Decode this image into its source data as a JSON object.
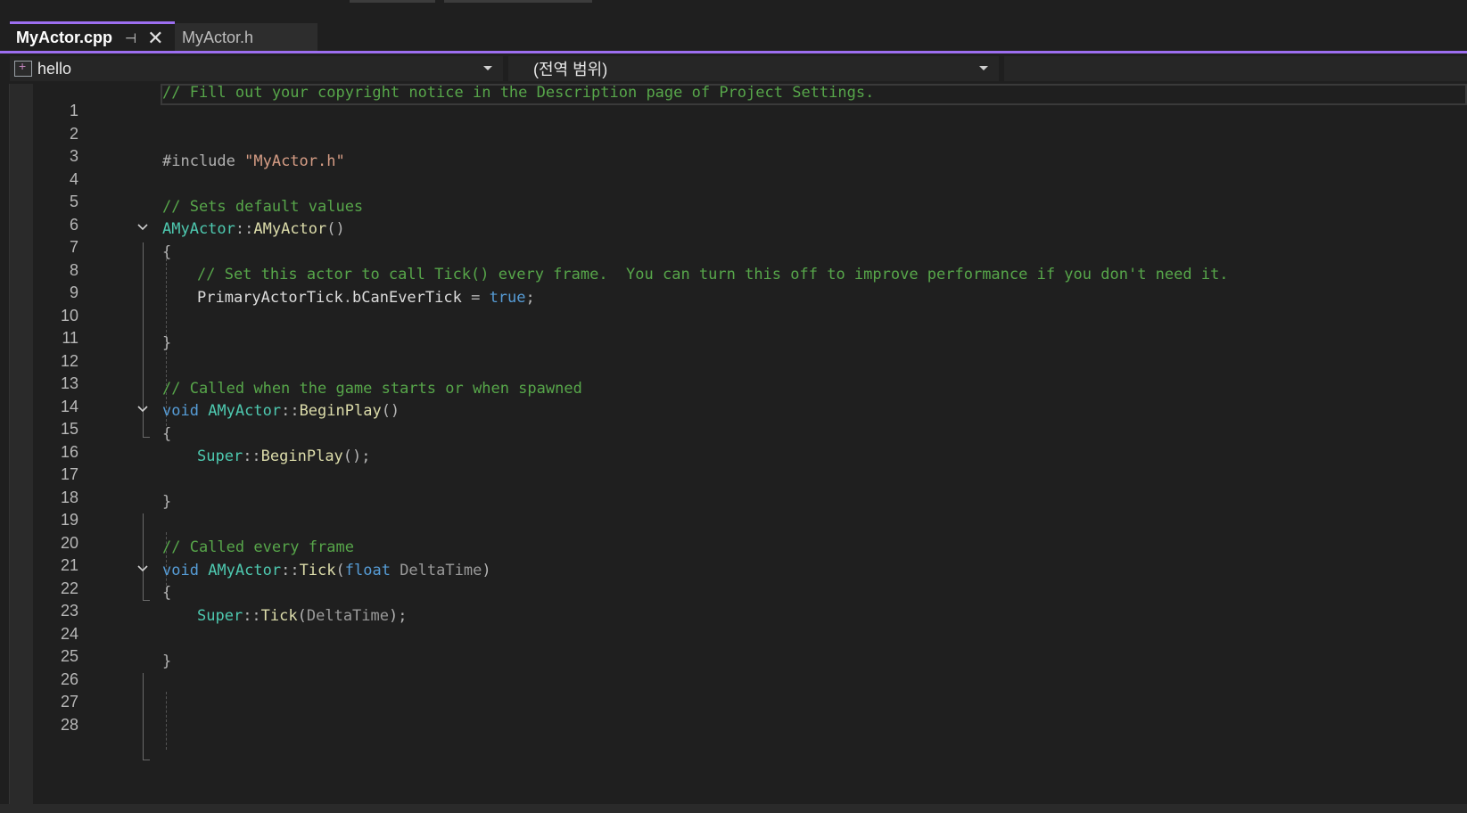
{
  "tabs": {
    "active": {
      "label": "MyActor.cpp",
      "pin_icon": "⊣",
      "close_icon": "✕"
    },
    "inactive": {
      "label": "MyActor.h"
    }
  },
  "navbar": {
    "project": "hello",
    "scope": "(전역 범위)"
  },
  "code": {
    "line_numbers": [
      "1",
      "2",
      "3",
      "4",
      "5",
      "6",
      "7",
      "8",
      "9",
      "10",
      "11",
      "12",
      "13",
      "14",
      "15",
      "16",
      "17",
      "18",
      "19",
      "20",
      "21",
      "22",
      "23",
      "24",
      "25",
      "26",
      "27",
      "28"
    ],
    "l1": "// Fill out your copyright notice in the Description page of Project Settings.",
    "l4_kw": "#include ",
    "l4_str": "\"MyActor.h\"",
    "l6": "// Sets default values",
    "l7_type": "AMyActor",
    "l7_sep": "::",
    "l7_fn": "AMyActor",
    "l7_paren": "()",
    "l8": "{",
    "l9": "// Set this actor to call Tick() every frame.  You can turn this off to improve performance if you don't need it.",
    "l10_a": "PrimaryActorTick",
    "l10_b": ".",
    "l10_c": "bCanEverTick",
    "l10_d": " = ",
    "l10_e": "true",
    "l10_f": ";",
    "l12": "}",
    "l14": "// Called when the game starts or when spawned",
    "l15_kw": "void ",
    "l15_type": "AMyActor",
    "l15_sep": "::",
    "l15_fn": "BeginPlay",
    "l15_paren": "()",
    "l16": "{",
    "l17_type": "Super",
    "l17_sep": "::",
    "l17_fn": "BeginPlay",
    "l17_end": "();",
    "l19": "}",
    "l21": "// Called every frame",
    "l22_kw": "void ",
    "l22_type": "AMyActor",
    "l22_sep": "::",
    "l22_fn": "Tick",
    "l22_open": "(",
    "l22_kw2": "float",
    "l22_param": " DeltaTime",
    "l22_close": ")",
    "l23": "{",
    "l24_type": "Super",
    "l24_sep": "::",
    "l24_fn": "Tick",
    "l24_open": "(",
    "l24_param": "DeltaTime",
    "l24_end": ");",
    "l26": "}"
  },
  "colors": {
    "accent": "#9c6ef0",
    "comment": "#57a64a",
    "type": "#4ec9b0",
    "keyword": "#569cd6",
    "string": "#d69d85"
  }
}
